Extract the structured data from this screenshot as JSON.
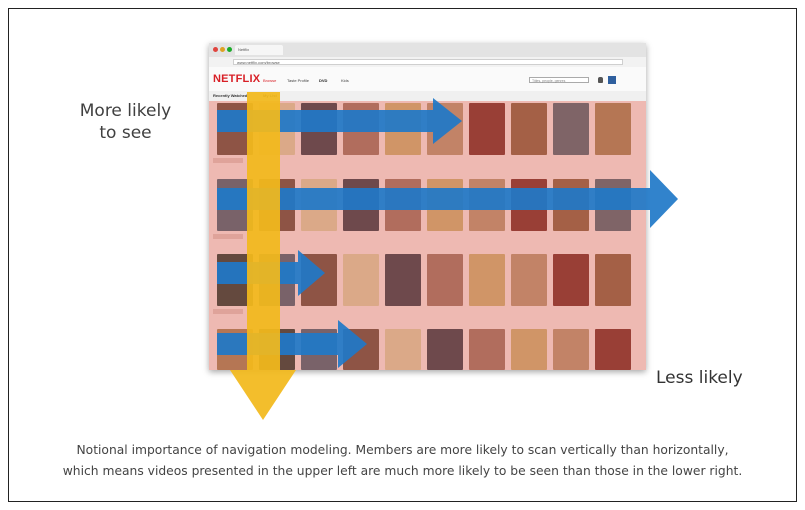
{
  "browser": {
    "tab_title": "Netflix",
    "url": "www.netflix.com/browse"
  },
  "app": {
    "logo": "NETFLIX",
    "nav_items": [
      "Browse",
      "Taste Profile",
      "DVD",
      "Kids"
    ],
    "search_placeholder": "Titles, people, genres",
    "row_labels": [
      "Recently Watched",
      "My List"
    ]
  },
  "annotations": {
    "more_likely": "More likely\nto see",
    "less_likely": "Less likely"
  },
  "caption": {
    "line1": "Notional importance of navigation modeling. Members are more likely to scan vertically than horizontally,",
    "line2": "which means videos presented in the upper left are much more likely to be seen than those in the lower right."
  },
  "colors": {
    "netflix_red": "#d81f26",
    "horizontal_arrow": "#1f78c8",
    "vertical_arrow": "#f2b91c",
    "overlay": "#e16e5f"
  },
  "poster_palette": [
    "#6b4a3a",
    "#8a5b3c",
    "#3d3a44",
    "#a37a4f",
    "#c9a66b",
    "#4c5e6e",
    "#7a2b25",
    "#d9c39a",
    "#55606a",
    "#9c6e5c",
    "#2f3a30",
    "#b58d6a"
  ]
}
